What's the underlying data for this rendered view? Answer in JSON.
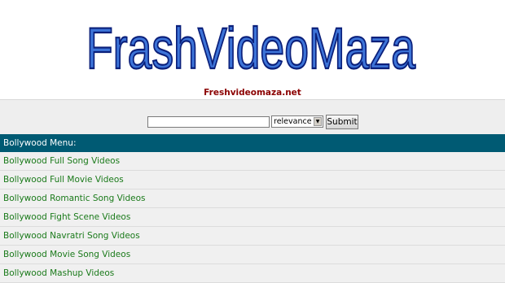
{
  "header": {
    "logo_text": "FrashVideoMaza",
    "site_url": "Freshvideomaza.net"
  },
  "search": {
    "input_value": "",
    "sort_selected": "relevance",
    "submit_label": "Submit"
  },
  "menu": {
    "title": "Bollywood Menu:",
    "items": [
      {
        "label": "Bollywood Full Song Videos"
      },
      {
        "label": "Bollywood Full Movie Videos"
      },
      {
        "label": "Bollywood Romantic Song Videos"
      },
      {
        "label": "Bollywood Fight Scene Videos"
      },
      {
        "label": "Bollywood Navratri Song Videos"
      },
      {
        "label": "Bollywood Movie Song Videos"
      },
      {
        "label": "Bollywood Mashup Videos"
      }
    ]
  },
  "colors": {
    "logo_fill": "#3d74d8",
    "logo_stroke": "#0a1f7a",
    "site_url": "#8b0000",
    "menu_header_bg": "#005a73",
    "menu_link": "#1a7a1a"
  }
}
